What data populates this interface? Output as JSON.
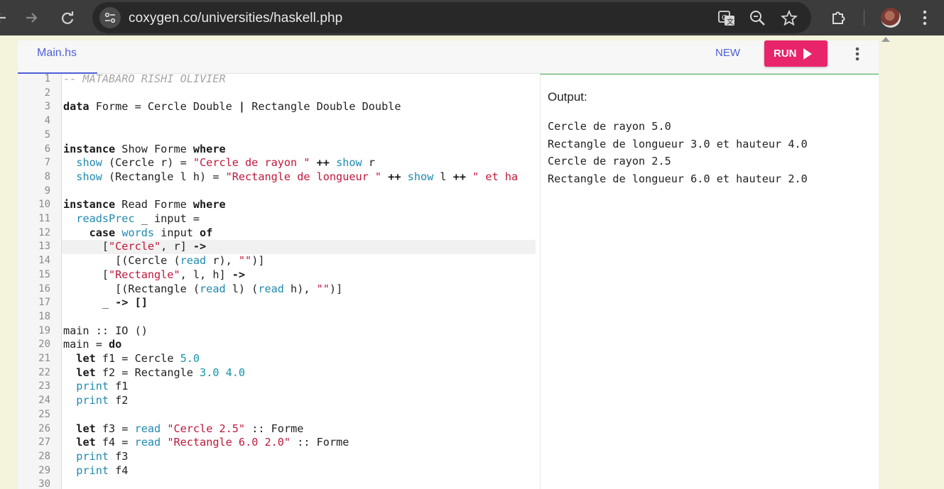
{
  "browser": {
    "url": "coxygen.co/universities/haskell.php",
    "icons": {
      "back": "back-arrow-icon",
      "forward": "forward-arrow-icon",
      "reload": "reload-icon",
      "site_info": "tune-icon",
      "translate": "translate-icon",
      "zoom": "zoom-icon",
      "bookmark": "star-icon",
      "extensions": "puzzle-icon",
      "profile": "avatar",
      "menu": "kebab-menu-icon"
    }
  },
  "toolbar": {
    "file_tab": "Main.hs",
    "new_label": "NEW",
    "run_label": "RUN",
    "accent_color": "#4e5fd8",
    "run_color": "#e8246b"
  },
  "editor": {
    "active_line": 13,
    "lines": [
      [
        [
          "t-cm",
          "-- MATABARO RISHI OLIVIER"
        ]
      ],
      [],
      [
        [
          "t-kw",
          "data"
        ],
        [
          "t-pl",
          " Forme = Cercle Double "
        ],
        [
          "t-op",
          "|"
        ],
        [
          "t-pl",
          " Rectangle Double Double"
        ]
      ],
      [],
      [],
      [
        [
          "t-kw",
          "instance"
        ],
        [
          "t-pl",
          " Show Forme "
        ],
        [
          "t-kw",
          "where"
        ]
      ],
      [
        [
          "t-pl",
          "  "
        ],
        [
          "t-fn",
          "show"
        ],
        [
          "t-pl",
          " (Cercle r) = "
        ],
        [
          "t-str",
          "\"Cercle de rayon \""
        ],
        [
          "t-pl",
          " "
        ],
        [
          "t-op",
          "++"
        ],
        [
          "t-pl",
          " "
        ],
        [
          "t-fn",
          "show"
        ],
        [
          "t-pl",
          " r"
        ]
      ],
      [
        [
          "t-pl",
          "  "
        ],
        [
          "t-fn",
          "show"
        ],
        [
          "t-pl",
          " (Rectangle l h) = "
        ],
        [
          "t-str",
          "\"Rectangle de longueur \""
        ],
        [
          "t-pl",
          " "
        ],
        [
          "t-op",
          "++"
        ],
        [
          "t-pl",
          " "
        ],
        [
          "t-fn",
          "show"
        ],
        [
          "t-pl",
          " l "
        ],
        [
          "t-op",
          "++"
        ],
        [
          "t-pl",
          " "
        ],
        [
          "t-str",
          "\" et ha"
        ]
      ],
      [],
      [
        [
          "t-kw",
          "instance"
        ],
        [
          "t-pl",
          " Read Forme "
        ],
        [
          "t-kw",
          "where"
        ]
      ],
      [
        [
          "t-pl",
          "  "
        ],
        [
          "t-fn",
          "readsPrec"
        ],
        [
          "t-pl",
          " _ input ="
        ]
      ],
      [
        [
          "t-pl",
          "    "
        ],
        [
          "t-kw",
          "case"
        ],
        [
          "t-pl",
          " "
        ],
        [
          "t-fn",
          "words"
        ],
        [
          "t-pl",
          " input "
        ],
        [
          "t-kw",
          "of"
        ]
      ],
      [
        [
          "t-pl",
          "      ["
        ],
        [
          "t-str",
          "\"Cercle\""
        ],
        [
          "t-pl",
          ", r] "
        ],
        [
          "t-op",
          "->"
        ]
      ],
      [
        [
          "t-pl",
          "        [(Cercle ("
        ],
        [
          "t-fn",
          "read"
        ],
        [
          "t-pl",
          " r), "
        ],
        [
          "t-str",
          "\"\""
        ],
        [
          "t-pl",
          ")]"
        ]
      ],
      [
        [
          "t-pl",
          "      ["
        ],
        [
          "t-str",
          "\"Rectangle\""
        ],
        [
          "t-pl",
          ", l, h] "
        ],
        [
          "t-op",
          "->"
        ]
      ],
      [
        [
          "t-pl",
          "        [(Rectangle ("
        ],
        [
          "t-fn",
          "read"
        ],
        [
          "t-pl",
          " l) ("
        ],
        [
          "t-fn",
          "read"
        ],
        [
          "t-pl",
          " h), "
        ],
        [
          "t-str",
          "\"\""
        ],
        [
          "t-pl",
          ")]"
        ]
      ],
      [
        [
          "t-pl",
          "      _ "
        ],
        [
          "t-op",
          "->"
        ],
        [
          "t-pl",
          " "
        ],
        [
          "t-op",
          "[]"
        ]
      ],
      [],
      [
        [
          "t-pl",
          "main :: IO ()"
        ]
      ],
      [
        [
          "t-pl",
          "main = "
        ],
        [
          "t-kw",
          "do"
        ]
      ],
      [
        [
          "t-pl",
          "  "
        ],
        [
          "t-kw",
          "let"
        ],
        [
          "t-pl",
          " f1 = Cercle "
        ],
        [
          "t-num",
          "5.0"
        ]
      ],
      [
        [
          "t-pl",
          "  "
        ],
        [
          "t-kw",
          "let"
        ],
        [
          "t-pl",
          " f2 = Rectangle "
        ],
        [
          "t-num",
          "3.0"
        ],
        [
          "t-pl",
          " "
        ],
        [
          "t-num",
          "4.0"
        ]
      ],
      [
        [
          "t-pl",
          "  "
        ],
        [
          "t-fn",
          "print"
        ],
        [
          "t-pl",
          " f1"
        ]
      ],
      [
        [
          "t-pl",
          "  "
        ],
        [
          "t-fn",
          "print"
        ],
        [
          "t-pl",
          " f2"
        ]
      ],
      [],
      [
        [
          "t-pl",
          "  "
        ],
        [
          "t-kw",
          "let"
        ],
        [
          "t-pl",
          " f3 = "
        ],
        [
          "t-fn",
          "read"
        ],
        [
          "t-pl",
          " "
        ],
        [
          "t-str",
          "\"Cercle 2.5\""
        ],
        [
          "t-pl",
          " :: Forme"
        ]
      ],
      [
        [
          "t-pl",
          "  "
        ],
        [
          "t-kw",
          "let"
        ],
        [
          "t-pl",
          " f4 = "
        ],
        [
          "t-fn",
          "read"
        ],
        [
          "t-pl",
          " "
        ],
        [
          "t-str",
          "\"Rectangle 6.0 2.0\""
        ],
        [
          "t-pl",
          " :: Forme"
        ]
      ],
      [
        [
          "t-pl",
          "  "
        ],
        [
          "t-fn",
          "print"
        ],
        [
          "t-pl",
          " f3"
        ]
      ],
      [
        [
          "t-pl",
          "  "
        ],
        [
          "t-fn",
          "print"
        ],
        [
          "t-pl",
          " f4"
        ]
      ],
      []
    ]
  },
  "output": {
    "label": "Output:",
    "lines": [
      "Cercle de rayon 5.0",
      "Rectangle de longueur 3.0 et hauteur 4.0",
      "Cercle de rayon 2.5",
      "Rectangle de longueur 6.0 et hauteur 2.0"
    ]
  }
}
